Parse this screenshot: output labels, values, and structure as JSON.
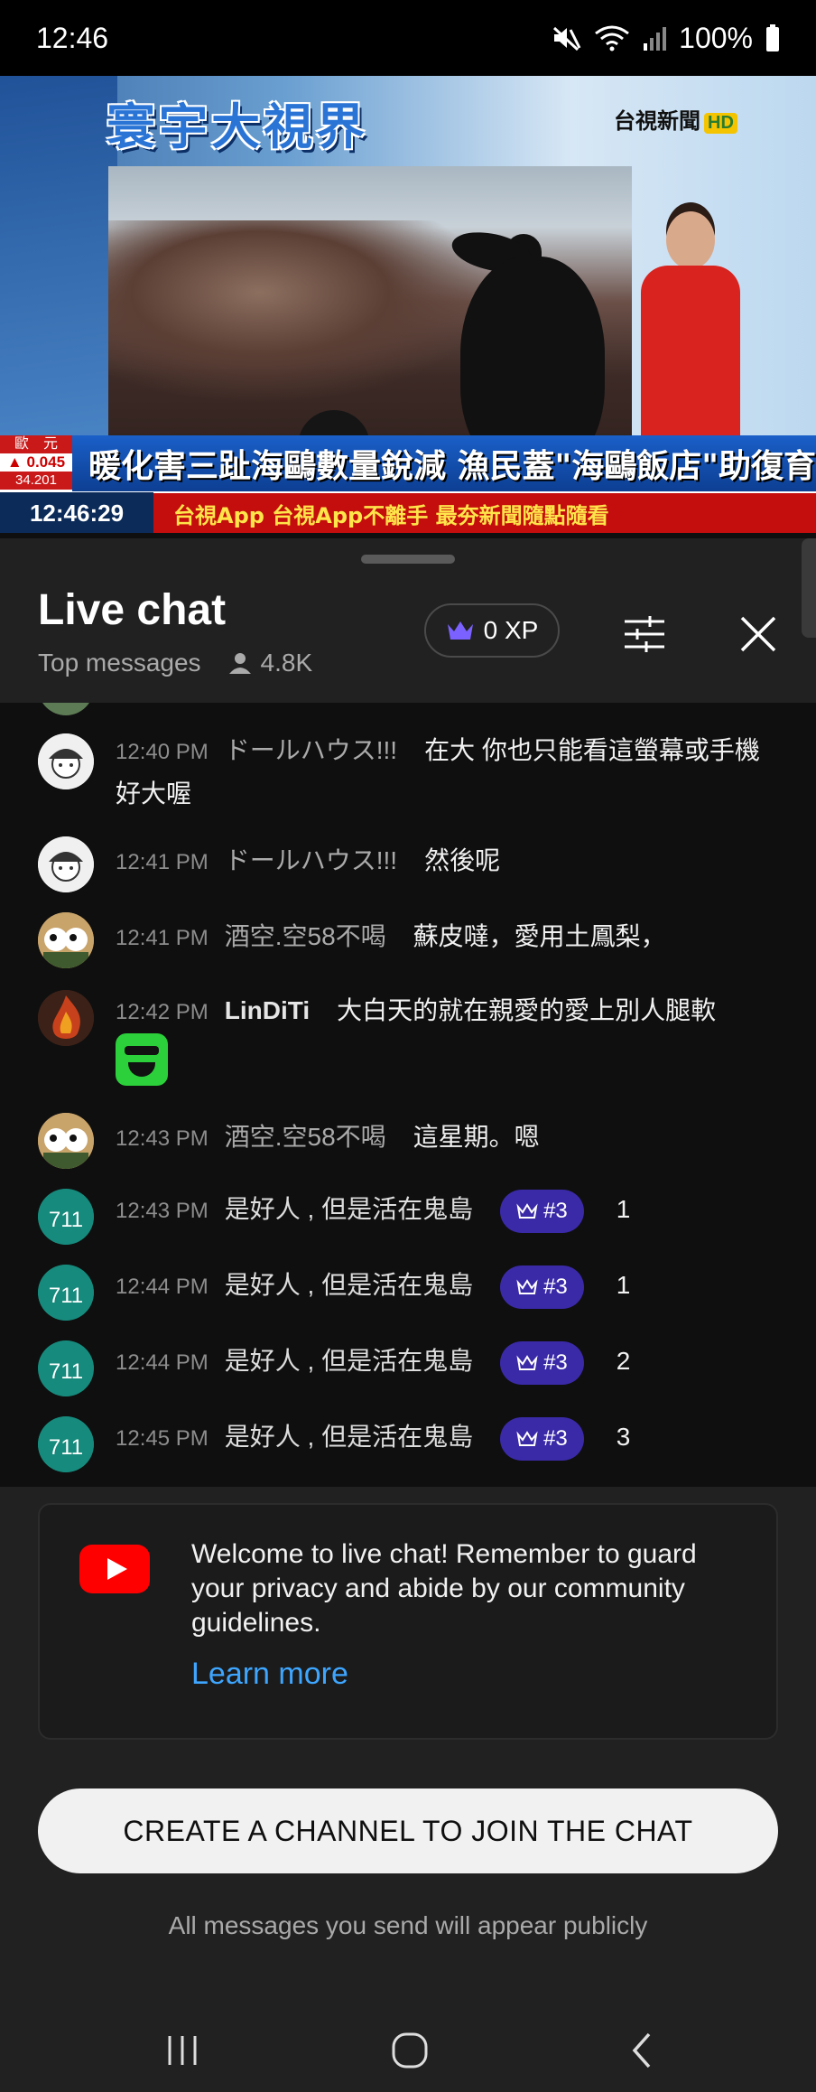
{
  "status_bar": {
    "time": "12:46",
    "battery": "100%",
    "icons": [
      "mute-icon",
      "wifi-icon",
      "signal-icon",
      "battery-icon"
    ]
  },
  "video": {
    "program_title": "寰宇大視界",
    "channel_name": "台視新聞",
    "channel_hd": "HD",
    "fx_label": "歐　元",
    "fx_change": "0.045",
    "fx_rate": "34.201",
    "headline": "暖化害三趾海鷗數量銳減 漁民蓋\"海鷗飯店\"助復育",
    "clock": "12:46:29",
    "ticker": "台視App 台視App不離手 最夯新聞隨點隨看"
  },
  "chat": {
    "title": "Live chat",
    "mode": "Top messages",
    "viewers": "4.8K",
    "xp": "0 XP",
    "messages": [
      {
        "time": "12:40 PM",
        "author": "ドールハウス!!!",
        "text": "在大 你也只能看這螢幕或手機 好大喔",
        "avatar": "avatar-doll"
      },
      {
        "time": "12:41 PM",
        "author": "ドールハウス!!!",
        "text": "然後呢",
        "avatar": "avatar-doll"
      },
      {
        "time": "12:41 PM",
        "author": "酒空.空58不喝",
        "text": "蘇皮噠，愛用土鳳梨，",
        "avatar": "avatar-panda"
      },
      {
        "time": "12:42 PM",
        "author": "LinDiTi",
        "text": "大白天的就在親愛的愛上別人腿軟",
        "avatar": "avatar-fire"
      },
      {
        "time": "12:43 PM",
        "author": "酒空.空58不喝",
        "text": "這星期。嗯",
        "avatar": "avatar-panda"
      },
      {
        "time": "12:43 PM",
        "author": "是好人 , 但是活在鬼島",
        "badge": "#3",
        "text": "1",
        "avatar": "avatar-711"
      },
      {
        "time": "12:44 PM",
        "author": "是好人 , 但是活在鬼島",
        "badge": "#3",
        "text": "1",
        "avatar": "avatar-711"
      },
      {
        "time": "12:44 PM",
        "author": "是好人 , 但是活在鬼島",
        "badge": "#3",
        "text": "2",
        "avatar": "avatar-711"
      },
      {
        "time": "12:45 PM",
        "author": "是好人 , 但是活在鬼島",
        "badge": "#3",
        "text": "3",
        "avatar": "avatar-711"
      }
    ],
    "avatar_711_label": "711"
  },
  "welcome": {
    "text": "Welcome to live chat! Remember to guard your privacy and abide by our community guidelines.",
    "learn_more": "Learn more"
  },
  "create_button": "CREATE A CHANNEL TO JOIN THE CHAT",
  "notice": "All messages you send will appear publicly",
  "colors": {
    "background": "#0f0f0f",
    "panel": "#212121",
    "badge": "#3a2aa8",
    "link": "#3ea6ff",
    "youtube_red": "#ff0000"
  }
}
